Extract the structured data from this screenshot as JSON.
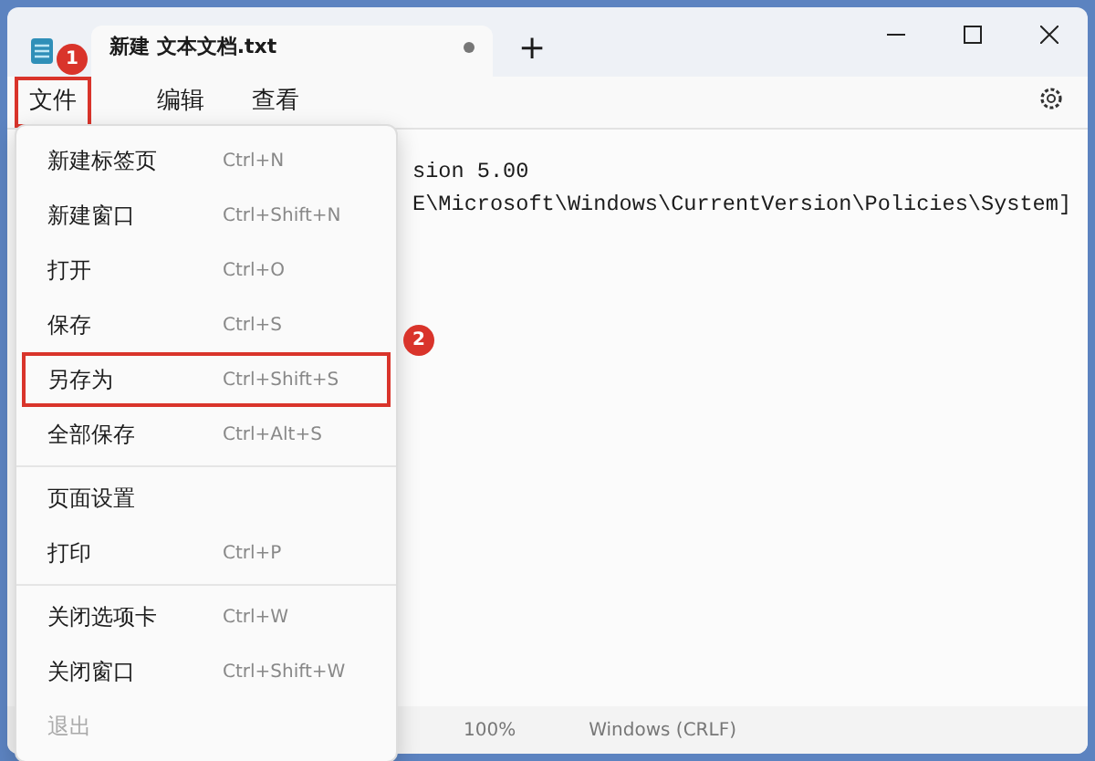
{
  "window": {
    "title": "新建 文本文档.txt",
    "unsaved": true,
    "new_tab": "+"
  },
  "menu_bar": [
    {
      "label": "文件",
      "highlighted": true,
      "badge": "1"
    },
    {
      "label": "编辑",
      "highlighted": false
    },
    {
      "label": "查看",
      "highlighted": false
    }
  ],
  "file_menu": {
    "groups": [
      [
        {
          "label": "新建标签页",
          "shortcut": "Ctrl+N",
          "disabled": false,
          "highlighted": false
        },
        {
          "label": "新建窗口",
          "shortcut": "Ctrl+Shift+N",
          "disabled": false,
          "highlighted": false
        },
        {
          "label": "打开",
          "shortcut": "Ctrl+O",
          "disabled": false,
          "highlighted": false
        },
        {
          "label": "保存",
          "shortcut": "Ctrl+S",
          "disabled": false,
          "highlighted": false
        },
        {
          "label": "另存为",
          "shortcut": "Ctrl+Shift+S",
          "disabled": false,
          "highlighted": true,
          "badge": "2"
        },
        {
          "label": "全部保存",
          "shortcut": "Ctrl+Alt+S",
          "disabled": false,
          "highlighted": false
        }
      ],
      [
        {
          "label": "页面设置",
          "disabled": false,
          "highlighted": false
        },
        {
          "label": "打印",
          "shortcut": "Ctrl+P",
          "disabled": false,
          "highlighted": false
        }
      ],
      [
        {
          "label": "关闭选项卡",
          "shortcut": "Ctrl+W",
          "disabled": false,
          "highlighted": false
        },
        {
          "label": "关闭窗口",
          "shortcut": "Ctrl+Shift+W",
          "disabled": false,
          "highlighted": false
        },
        {
          "label": "退出",
          "disabled": true,
          "highlighted": false
        }
      ]
    ]
  },
  "editor": {
    "lines": [
      "sion 5.00",
      "E\\Microsoft\\Windows\\CurrentVersion\\Policies\\System]"
    ]
  },
  "status_bar": {
    "zoom": "100%",
    "line_ending": "Windows (CRLF)"
  }
}
